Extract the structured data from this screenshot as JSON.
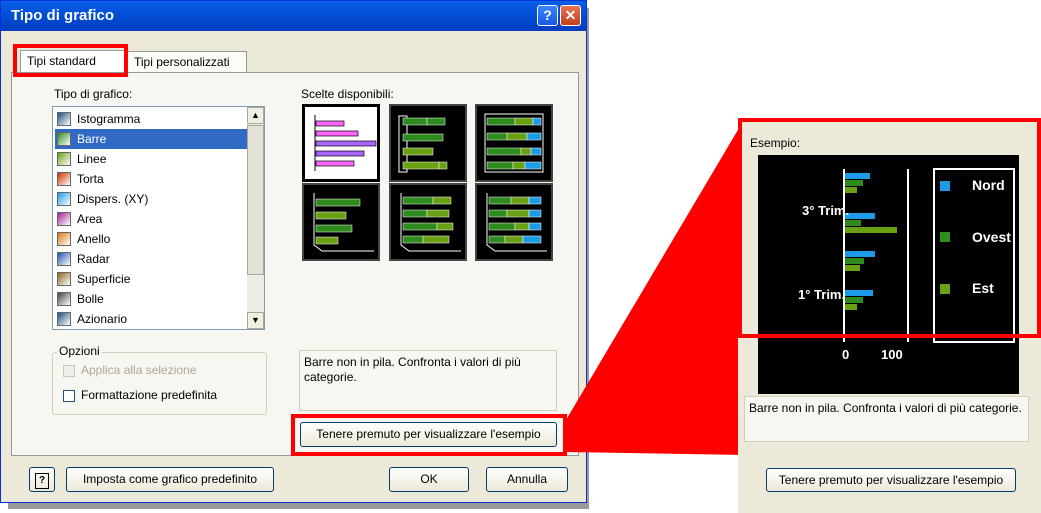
{
  "dialog": {
    "title": "Tipo di grafico",
    "help_glyph": "?",
    "close_glyph": "✕",
    "tabs": [
      {
        "label": "Tipi standard",
        "selected": true
      },
      {
        "label": "Tipi personalizzati",
        "selected": false
      }
    ],
    "chart_type_label": "Tipo di grafico:",
    "chart_types": [
      {
        "label": "Istogramma",
        "icon": "column-chart-icon"
      },
      {
        "label": "Barre",
        "icon": "bar-chart-icon",
        "selected": true
      },
      {
        "label": "Linee",
        "icon": "line-chart-icon"
      },
      {
        "label": "Torta",
        "icon": "pie-chart-icon"
      },
      {
        "label": "Dispers. (XY)",
        "icon": "scatter-chart-icon"
      },
      {
        "label": "Area",
        "icon": "area-chart-icon"
      },
      {
        "label": "Anello",
        "icon": "doughnut-chart-icon"
      },
      {
        "label": "Radar",
        "icon": "radar-chart-icon"
      },
      {
        "label": "Superficie",
        "icon": "surface-chart-icon"
      },
      {
        "label": "Bolle",
        "icon": "bubble-chart-icon"
      },
      {
        "label": "Azionario",
        "icon": "stock-chart-icon"
      }
    ],
    "subtype_label": "Scelte disponibili:",
    "options_group": "Opzioni",
    "apply_to_selection": "Applica alla selezione",
    "default_formatting": "Formattazione predefinita",
    "description": "Barre non in pila. Confronta i valori di più categorie.",
    "press_hold_button": "Tenere premuto per visualizzare l'esempio",
    "set_default_button": "Imposta come grafico predefinito",
    "ok_button": "OK",
    "cancel_button": "Annulla"
  },
  "zoom_panel": {
    "sample_label": "Esempio:",
    "description": "Barre non in pila. Confronta i valori di più categorie.",
    "press_hold_button": "Tenere premuto per visualizzare l'esempio",
    "chart": {
      "categories_visible": [
        "3° Trim.",
        "1° Trim."
      ],
      "axis_ticks": [
        "0",
        "100"
      ],
      "legend": [
        {
          "name": "Nord",
          "color": "#1e9be8"
        },
        {
          "name": "Ovest",
          "color": "#2e8b1e"
        },
        {
          "name": "Est",
          "color": "#6aa014"
        }
      ]
    }
  },
  "colors": {
    "highlight": "#ff0000",
    "selection": "#316ac5",
    "title_bar": "#0350d8"
  }
}
